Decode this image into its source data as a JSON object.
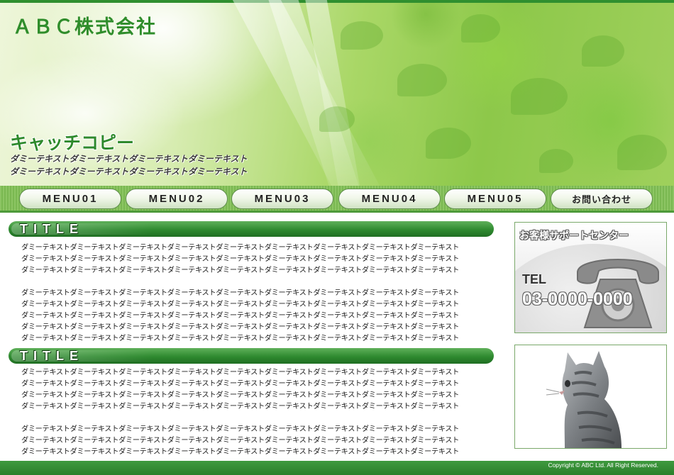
{
  "header": {
    "logo": "ＡＢＣ株式会社",
    "catch_title": "キャッチコピー",
    "catch_lines": [
      "ダミーテキストダミーテキストダミーテキストダミーテキスト",
      "ダミーテキストダミーテキストダミーテキストダミーテキスト"
    ]
  },
  "nav": {
    "items": [
      {
        "label": "MENU01"
      },
      {
        "label": "MENU02"
      },
      {
        "label": "MENU03"
      },
      {
        "label": "MENU04"
      },
      {
        "label": "MENU05"
      },
      {
        "label": "お問い合わせ"
      }
    ]
  },
  "main": {
    "sections": [
      {
        "title": "TITLE",
        "paragraphs": [
          [
            "ダミーテキストダミーテキストダミーテキストダミーテキストダミーテキストダミーテキストダミーテキストダミーテキストダミーテキスト",
            "ダミーテキストダミーテキストダミーテキストダミーテキストダミーテキストダミーテキストダミーテキストダミーテキストダミーテキスト",
            "ダミーテキストダミーテキストダミーテキストダミーテキストダミーテキストダミーテキストダミーテキストダミーテキストダミーテキスト"
          ],
          [
            "ダミーテキストダミーテキストダミーテキストダミーテキストダミーテキストダミーテキストダミーテキストダミーテキストダミーテキスト",
            "ダミーテキストダミーテキストダミーテキストダミーテキストダミーテキストダミーテキストダミーテキストダミーテキストダミーテキスト",
            "ダミーテキストダミーテキストダミーテキストダミーテキストダミーテキストダミーテキストダミーテキストダミーテキストダミーテキスト",
            "ダミーテキストダミーテキストダミーテキストダミーテキストダミーテキストダミーテキストダミーテキストダミーテキストダミーテキスト",
            "ダミーテキストダミーテキストダミーテキストダミーテキストダミーテキストダミーテキストダミーテキストダミーテキストダミーテキスト"
          ]
        ]
      },
      {
        "title": "TITLE",
        "paragraphs": [
          [
            "ダミーテキストダミーテキストダミーテキストダミーテキストダミーテキストダミーテキストダミーテキストダミーテキストダミーテキスト",
            "ダミーテキストダミーテキストダミーテキストダミーテキストダミーテキストダミーテキストダミーテキストダミーテキストダミーテキスト",
            "ダミーテキストダミーテキストダミーテキストダミーテキストダミーテキストダミーテキストダミーテキストダミーテキストダミーテキスト",
            "ダミーテキストダミーテキストダミーテキストダミーテキストダミーテキストダミーテキストダミーテキストダミーテキストダミーテキスト"
          ],
          [
            "ダミーテキストダミーテキストダミーテキストダミーテキストダミーテキストダミーテキストダミーテキストダミーテキストダミーテキスト",
            "ダミーテキストダミーテキストダミーテキストダミーテキストダミーテキストダミーテキストダミーテキストダミーテキストダミーテキスト",
            "ダミーテキストダミーテキストダミーテキストダミーテキストダミーテキストダミーテキストダミーテキストダミーテキストダミーテキスト"
          ]
        ]
      }
    ]
  },
  "sidebar": {
    "support": {
      "title": "お客様サポートセンター",
      "tel_label": "TEL",
      "tel_number": "03-0000-0000",
      "icon": "telephone-icon"
    },
    "image": {
      "icon": "kitten-photo"
    }
  },
  "footer": {
    "copyright": "Copyright © ABC Ltd. All Right Reserved."
  },
  "colors": {
    "brand_green": "#2f8d2b",
    "nav_green": "#7ab851",
    "footer_green": "#2a7f2b"
  }
}
